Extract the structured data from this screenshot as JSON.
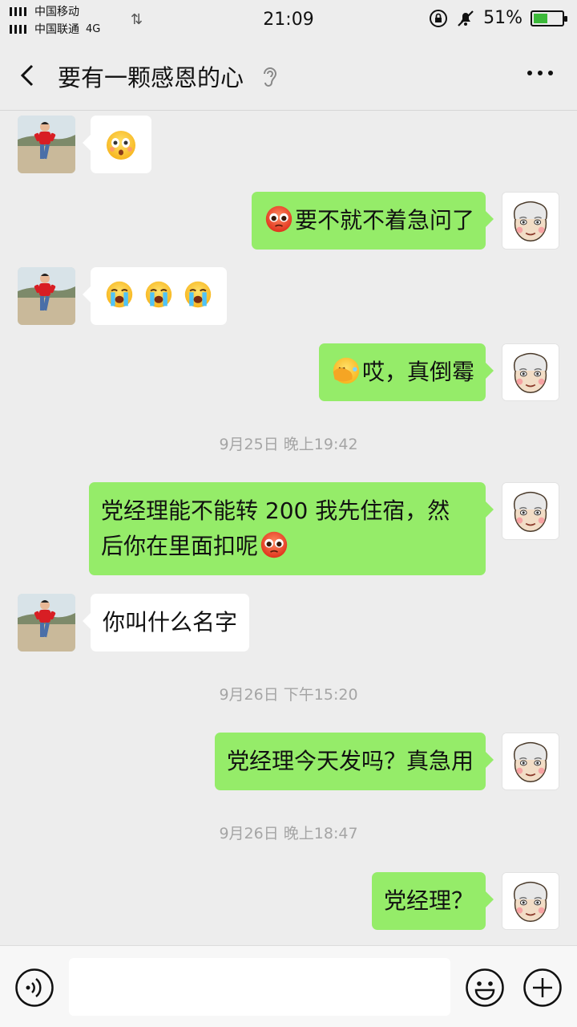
{
  "status_bar": {
    "carrier_1": "中国移动",
    "carrier_2": "中国联通",
    "network": "4G",
    "time": "21:09",
    "battery": "51%",
    "battery_level": 0.51
  },
  "header": {
    "title": "要有一颗感恩的心",
    "back_icon": "chevron-left-icon",
    "earpiece_icon": "ear-icon",
    "more_icon": "more-horizontal-icon"
  },
  "messages": [
    {
      "side": "in",
      "text": "",
      "emoji": [
        "flushed"
      ]
    },
    {
      "side": "out",
      "text": "要不就不着急问了",
      "emoji_prefix": "pleading"
    },
    {
      "side": "in",
      "text": "",
      "emoji": [
        "loudly-crying",
        "loudly-crying",
        "loudly-crying"
      ]
    },
    {
      "side": "out",
      "text": "哎，真倒霉",
      "emoji_prefix": "facepalm"
    },
    {
      "timestamp": "9月25日 晚上19:42"
    },
    {
      "side": "out",
      "line1": "党经理能不能转 200 我先住宿，然",
      "line2": "后你在里面扣呢",
      "emoji_suffix": "pleading"
    },
    {
      "side": "in",
      "text": "你叫什么名字"
    },
    {
      "timestamp": "9月26日 下午15:20"
    },
    {
      "side": "out",
      "text": "党经理今天发吗？真急用"
    },
    {
      "timestamp": "9月26日 晚上18:47"
    },
    {
      "side": "out",
      "text": "党经理？"
    }
  ],
  "input_bar": {
    "voice_icon": "voice-icon",
    "emoji_icon": "smile-icon",
    "plus_icon": "plus-icon"
  },
  "colors": {
    "background": "#ededed",
    "outgoing_bubble": "#95ec69",
    "incoming_bubble": "#ffffff",
    "timestamp": "#a5a5a5"
  }
}
